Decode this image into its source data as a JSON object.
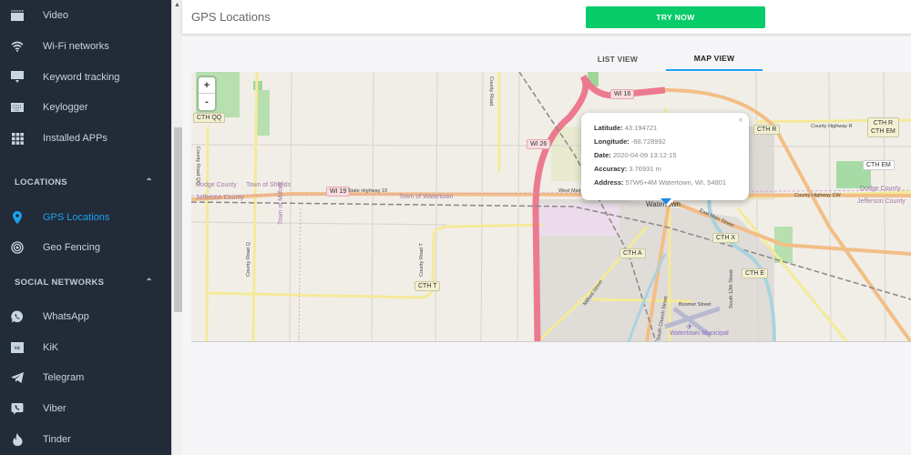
{
  "sidebar": {
    "items_top": [
      {
        "label": "Video",
        "icon": "video-icon"
      },
      {
        "label": "Wi-Fi networks",
        "icon": "wifi-icon"
      },
      {
        "label": "Keyword tracking",
        "icon": "keyword-tracking-icon"
      },
      {
        "label": "Keylogger",
        "icon": "keyboard-icon"
      },
      {
        "label": "Installed APPs",
        "icon": "apps-grid-icon"
      }
    ],
    "sections": [
      {
        "title": "LOCATIONS",
        "items": [
          {
            "label": "GPS Locations",
            "icon": "map-pin-icon",
            "active": true
          },
          {
            "label": "Geo Fencing",
            "icon": "geofence-icon"
          }
        ]
      },
      {
        "title": "SOCIAL NETWORKS",
        "items": [
          {
            "label": "WhatsApp",
            "icon": "whatsapp-icon"
          },
          {
            "label": "KiK",
            "icon": "kik-icon"
          },
          {
            "label": "Telegram",
            "icon": "telegram-icon"
          },
          {
            "label": "Viber",
            "icon": "viber-icon"
          },
          {
            "label": "Tinder",
            "icon": "tinder-icon"
          }
        ]
      }
    ]
  },
  "header": {
    "title": "GPS Locations",
    "try_now_label": "TRY NOW"
  },
  "tabs": [
    {
      "label": "LIST VIEW",
      "active": false
    },
    {
      "label": "MAP VIEW",
      "active": true
    }
  ],
  "map": {
    "zoom_in": "+",
    "zoom_out": "-",
    "popup": {
      "latitude_label": "Latitude:",
      "latitude": "43.194721",
      "longitude_label": "Longitude:",
      "longitude": "-88.728992",
      "date_label": "Date:",
      "date": "2020-04-09 13:12:15",
      "accuracy_label": "Accuracy:",
      "accuracy": "3.76931 m",
      "address_label": "Address:",
      "address": "57W6+4M Watertown, WI, 54801",
      "close": "×"
    },
    "labels": {
      "cth_qq": "CTH QQ",
      "county_road_qq": "County Road QQ",
      "dodge_county_w": "Dodge County",
      "jefferson_county_w": "Jefferson County",
      "town_of_shields": "Town of Shields",
      "wi_19": "WI 19",
      "state_highway_19": "State Highway 19",
      "town_of_watertown": "Town of Watertown",
      "town_of_milford": "Town of Milford",
      "county_road_q": "County Road Q",
      "county_road_t": "County Road T",
      "cth_t": "CTH T",
      "wi_26": "WI 26",
      "wi_16": "WI 16",
      "county_road_l": "County Road",
      "west_main": "West Main",
      "watertown": "Watertown",
      "east_main_street": "East Main Street",
      "cth_a": "CTH A",
      "milford_street": "Milford Street",
      "south_church_street": "South Church Street",
      "south_12th_street": "South 12th Street",
      "boomer_street": "Boomer Street",
      "cth_x": "CTH X",
      "cth_e": "CTH E",
      "watertown_municipal": "Watertown Municipal",
      "cth_r": "CTH R",
      "county_highway_r": "County Highway R",
      "cth_r_em_1": "CTH R",
      "cth_r_em_2": "CTH EM",
      "cth_em": "CTH EM",
      "county_highway_cw": "County Highway CW",
      "dodge_county_e": "Dodge County",
      "jefferson_county_e": "Jefferson County"
    }
  }
}
